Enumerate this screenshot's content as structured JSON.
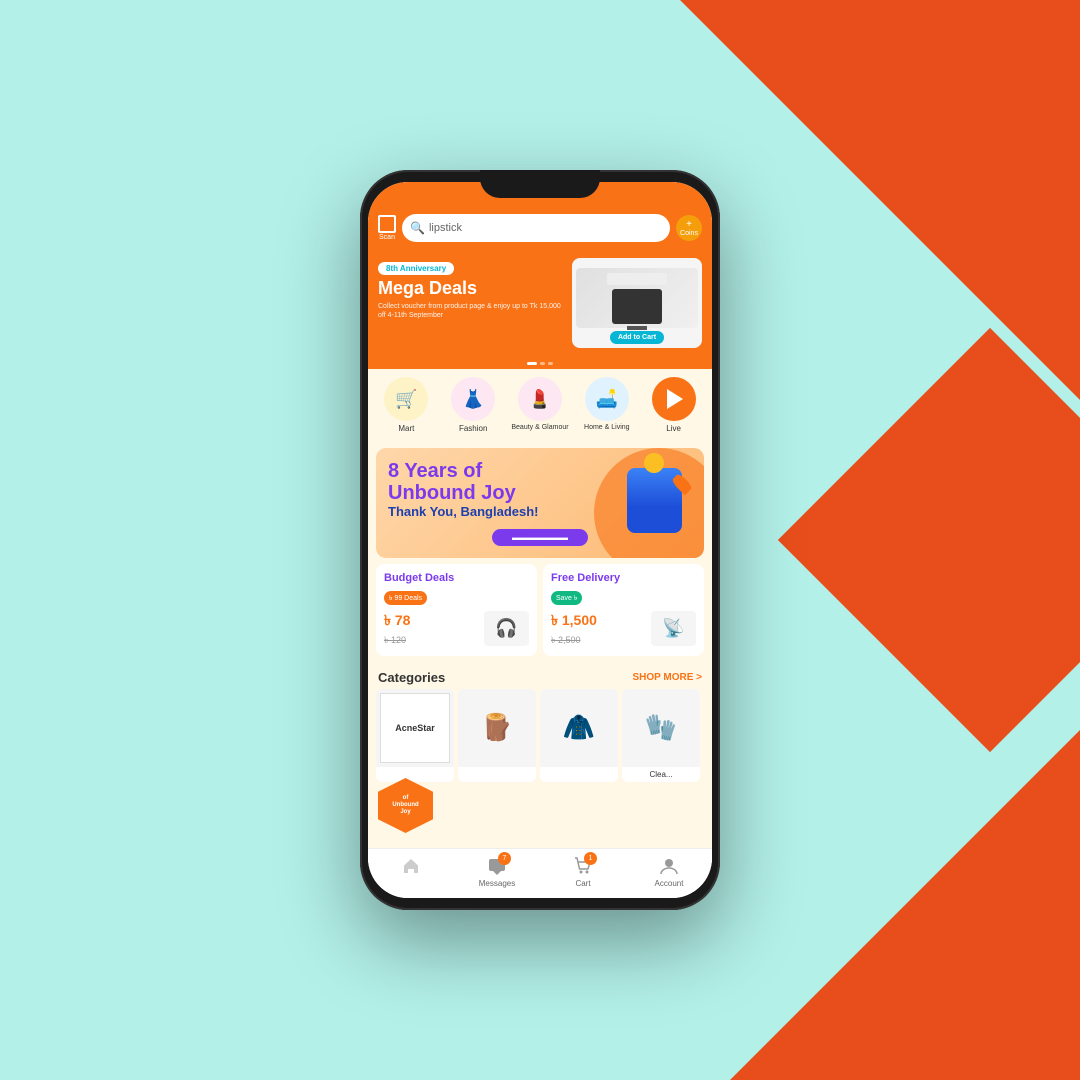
{
  "background": {
    "main_color": "#b2f0e8",
    "accent_color": "#e84e1b"
  },
  "phone": {
    "screen_bg": "#fff8e7"
  },
  "header": {
    "scan_label": "Scan",
    "search_placeholder": "lipstick",
    "coins_label": "Coins"
  },
  "banner": {
    "anniversary_badge": "8th Anniversary",
    "title": "Mega Deals",
    "description": "Collect voucher from product page & enjoy up to Tk 15,000 off 4-11th September",
    "add_to_cart": "Add to Cart"
  },
  "categories": [
    {
      "label": "Mart",
      "emoji": "🛒"
    },
    {
      "label": "Fashion",
      "emoji": "👗"
    },
    {
      "label": "Beauty &\nGlamour",
      "emoji": "💄"
    },
    {
      "label": "Home &\nLiving",
      "emoji": "🛋️"
    },
    {
      "label": "Live",
      "emoji": "▶"
    }
  ],
  "promo": {
    "years_text": "8 Years of",
    "main_text": "Unbound Joy",
    "subtitle": "Thank You, Bangladesh!"
  },
  "budget_deals": {
    "title": "Budget Deals",
    "badge": "৳ 99 Deals",
    "price": "৳ 78",
    "original_price": "৳ 120"
  },
  "free_delivery": {
    "title": "Free Delivery",
    "badge": "Save ৳",
    "price": "৳ 1,500",
    "original_price": "৳ 2,500"
  },
  "categories_section": {
    "heading": "Categories",
    "shop_more": "SHOP MORE >"
  },
  "products": [
    {
      "label": "AcneStar",
      "type": "acne"
    },
    {
      "label": "",
      "type": "stand"
    },
    {
      "label": "",
      "type": "coat"
    },
    {
      "label": "Clea...",
      "type": "glove"
    }
  ],
  "bottom_nav": [
    {
      "label": "Messages",
      "badge": "7",
      "icon": "message"
    },
    {
      "label": "Cart",
      "badge": "1",
      "icon": "cart"
    },
    {
      "label": "Account",
      "badge": "",
      "icon": "account"
    }
  ],
  "corner_badge": {
    "line1": "of",
    "line2": "Unbound",
    "line3": "Joy"
  }
}
